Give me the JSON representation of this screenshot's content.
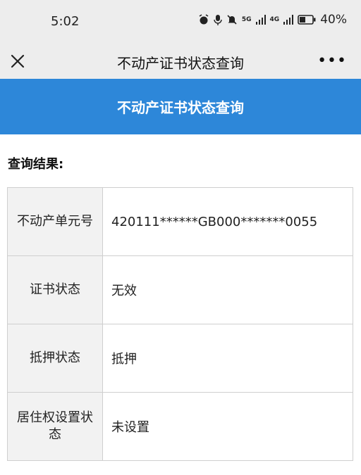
{
  "status_bar": {
    "time": "5:02",
    "net1": "5G",
    "net2": "4G",
    "battery": "40%"
  },
  "nav": {
    "title": "不动产证书状态查询"
  },
  "banner": {
    "title": "不动产证书状态查询"
  },
  "result": {
    "heading": "查询结果:",
    "rows": [
      {
        "label": "不动产单元号",
        "value": "420111******GB000*******0055"
      },
      {
        "label": "证书状态",
        "value": "无效"
      },
      {
        "label": "抵押状态",
        "value": "抵押"
      },
      {
        "label": "居住权设置状态",
        "value": "未设置"
      }
    ]
  },
  "colors": {
    "banner": "#2d87d9",
    "topbar": "#ededed",
    "label_bg": "#f2f2f2"
  }
}
